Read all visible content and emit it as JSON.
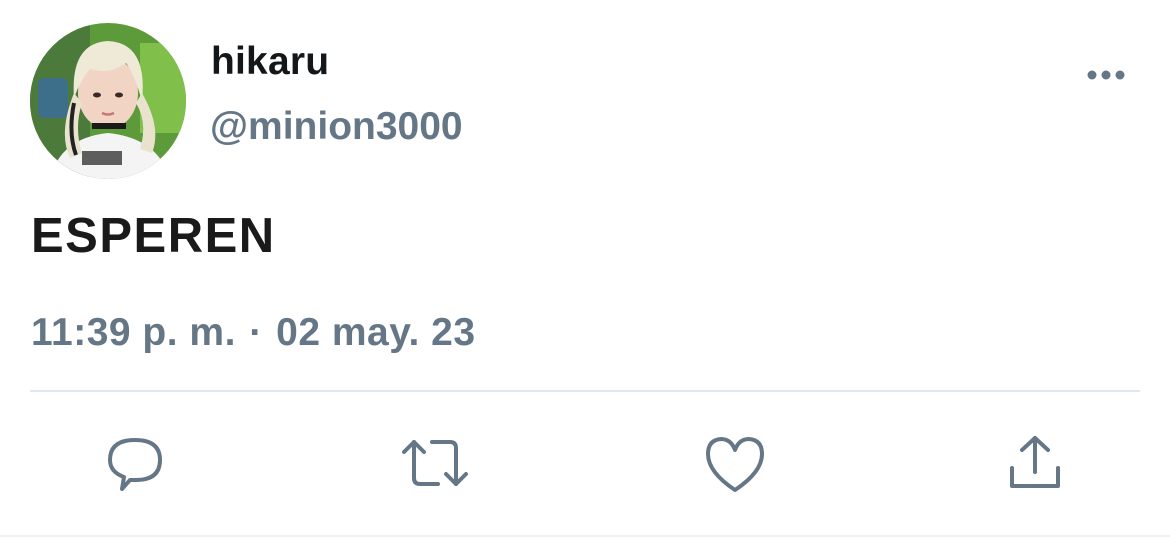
{
  "user": {
    "display_name": "hikaru",
    "handle": "@minion3000",
    "avatar_icon": "profile-photo"
  },
  "tweet": {
    "text": "ESPEREN",
    "time": "11:39 p. m.",
    "separator": "·",
    "date": "02 may. 23"
  },
  "actions": {
    "more": "more-options-icon",
    "reply": "reply-icon",
    "retweet": "retweet-icon",
    "like": "heart-icon",
    "share": "share-icon"
  },
  "colors": {
    "name": "#14171a",
    "secondary": "#657786",
    "icon": "#657786",
    "divider": "#e1e8ed"
  }
}
